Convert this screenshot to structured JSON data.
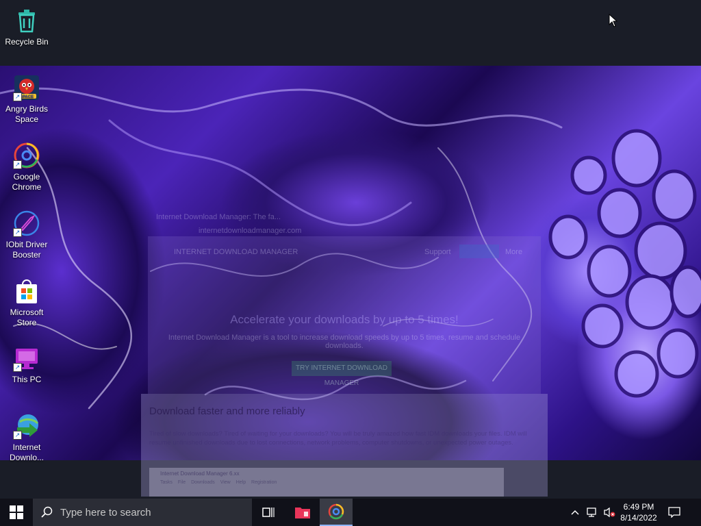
{
  "desktop": {
    "icons": [
      {
        "label": "Recycle Bin",
        "icon": "recycle-bin-icon"
      },
      {
        "label": "Angry Birds Space",
        "icon": "angry-birds-space-icon"
      },
      {
        "label": "Google Chrome",
        "icon": "chrome-icon"
      },
      {
        "label": "IObit Driver Booster",
        "icon": "driver-booster-icon"
      },
      {
        "label": "Microsoft Store",
        "icon": "microsoft-store-icon"
      },
      {
        "label": "This PC",
        "icon": "this-pc-icon"
      },
      {
        "label": "Internet Downlo...",
        "icon": "internet-download-manager-icon"
      }
    ]
  },
  "ghost_window": {
    "tab_title": "Internet Download Manager: The fa...",
    "url": "internetdownloadmanager.com",
    "nav_brand": "INTERNET DOWNLOAD MANAGER",
    "nav_link": "Support",
    "nav_more": "More",
    "headline": "Accelerate your downloads by up to 5 times!",
    "subtext": "Internet Download Manager is a tool to increase download speeds by up to 5 times, resume and schedule downloads.",
    "cta": "TRY INTERNET DOWNLOAD MANAGER",
    "section_title": "Download faster and more reliably",
    "section_text": "Tired of slow downloads? Tired of waiting for your downloads? You will be truly amazed how fast IDM downloads your files. IDM will resume unfinished downloads due to lost connections, network problems, computer shutdowns, or unexpected power outages.",
    "mini_title": "Internet Download Manager 6.xx",
    "mini_menu": [
      "Tasks",
      "File",
      "Downloads",
      "View",
      "Help",
      "Registration"
    ]
  },
  "taskbar": {
    "start_icon": "windows-start-icon",
    "search_placeholder": "Type here to search",
    "task_view_icon": "task-view-icon",
    "apps": [
      {
        "name": "File Explorer",
        "icon": "file-explorer-icon",
        "active": false
      },
      {
        "name": "Google Chrome",
        "icon": "chrome-icon",
        "active": true
      }
    ],
    "tray": {
      "time": "6:49 PM",
      "date": "8/14/2022"
    }
  },
  "colors": {
    "taskbar_bg": "#101119",
    "search_bg": "#2b2d36",
    "desktop_top": "#1a1d27",
    "wallpaper_accent": "#6a44e0"
  }
}
